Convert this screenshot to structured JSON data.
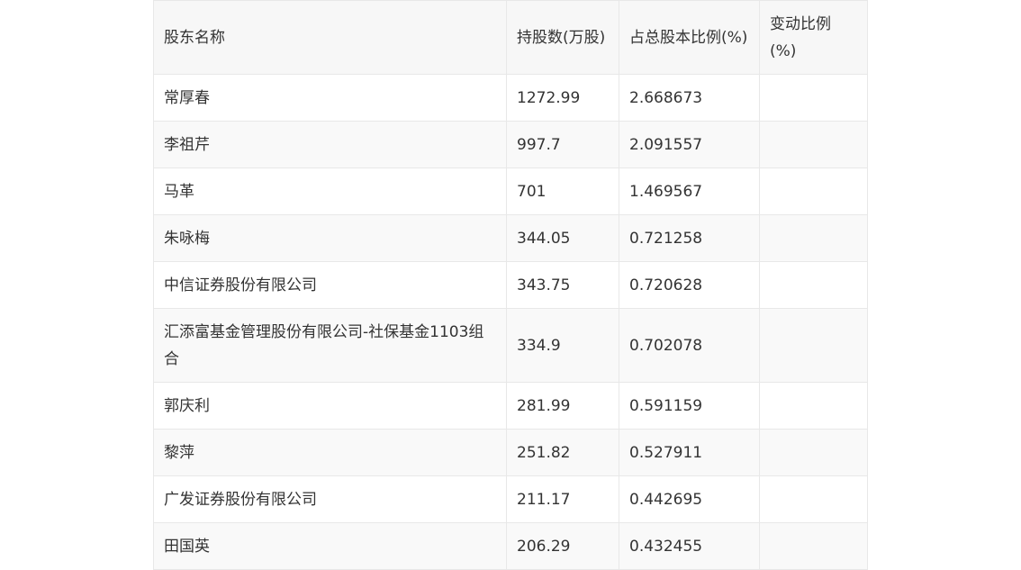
{
  "table": {
    "headers": [
      "股东名称",
      "持股数(万股)",
      "占总股本比例(%)",
      "变动比例(%)"
    ],
    "rows": [
      {
        "name": "常厚春",
        "shares": "1272.99",
        "ratio": "2.668673",
        "change": ""
      },
      {
        "name": "李祖芹",
        "shares": "997.7",
        "ratio": "2.091557",
        "change": ""
      },
      {
        "name": "马革",
        "shares": "701",
        "ratio": "1.469567",
        "change": ""
      },
      {
        "name": "朱咏梅",
        "shares": "344.05",
        "ratio": "0.721258",
        "change": ""
      },
      {
        "name": "中信证券股份有限公司",
        "shares": "343.75",
        "ratio": "0.720628",
        "change": ""
      },
      {
        "name": "汇添富基金管理股份有限公司-社保基金1103组合",
        "shares": "334.9",
        "ratio": "0.702078",
        "change": ""
      },
      {
        "name": "郭庆利",
        "shares": "281.99",
        "ratio": "0.591159",
        "change": ""
      },
      {
        "name": "黎萍",
        "shares": "251.82",
        "ratio": "0.527911",
        "change": ""
      },
      {
        "name": "广发证券股份有限公司",
        "shares": "211.17",
        "ratio": "0.442695",
        "change": ""
      },
      {
        "name": "田国英",
        "shares": "206.29",
        "ratio": "0.432455",
        "change": ""
      }
    ]
  }
}
